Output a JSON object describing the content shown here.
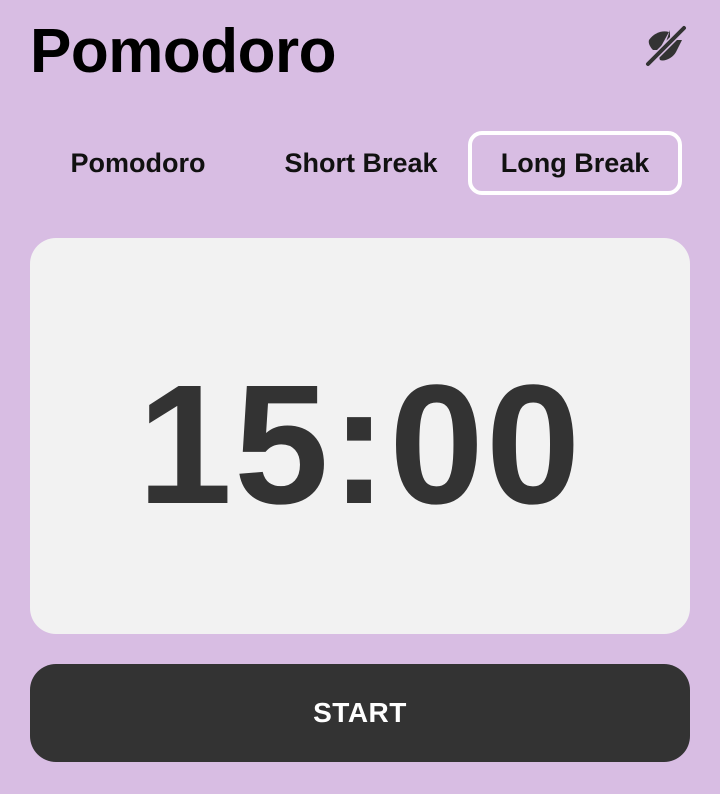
{
  "app": {
    "title": "Pomodoro",
    "toggle_icon": "eye-slash-icon",
    "colors": {
      "background": "#d8bde3",
      "card": "#f2f2f2",
      "dark": "#333333",
      "active_tab_border": "#ffffff"
    }
  },
  "tabs": [
    {
      "label": "Pomodoro",
      "active": false
    },
    {
      "label": "Short Break",
      "active": false
    },
    {
      "label": "Long Break",
      "active": true
    }
  ],
  "timer": {
    "display": "15:00"
  },
  "controls": {
    "start_label": "START"
  }
}
